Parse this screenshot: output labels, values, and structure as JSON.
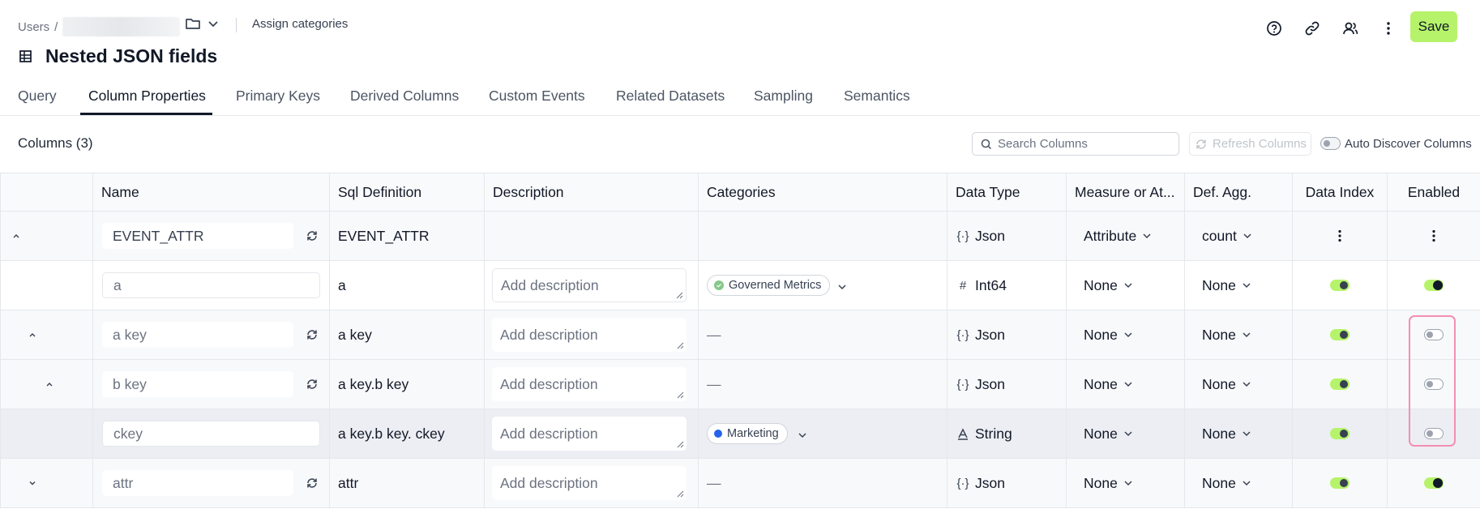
{
  "header": {
    "breadcrumb_root": "Users",
    "breadcrumb_sep": "/",
    "assign_categories": "Assign categories",
    "title": "Nested JSON fields",
    "save_label": "Save"
  },
  "tabs": [
    {
      "label": "Query"
    },
    {
      "label": "Column Properties",
      "active": true
    },
    {
      "label": "Primary Keys"
    },
    {
      "label": "Derived Columns"
    },
    {
      "label": "Custom Events"
    },
    {
      "label": "Related Datasets"
    },
    {
      "label": "Sampling"
    },
    {
      "label": "Semantics"
    }
  ],
  "toolbar": {
    "columns_count": "Columns (3)",
    "search_placeholder": "Search Columns",
    "refresh_label": "Refresh Columns",
    "auto_discover_label": "Auto Discover Columns"
  },
  "table": {
    "headers": [
      "Name",
      "Sql Definition",
      "Description",
      "Categories",
      "Data Type",
      "Measure or At...",
      "Def. Agg.",
      "Data Index",
      "Enabled"
    ],
    "rows": [
      {
        "name": "EVENT_ATTR",
        "sql": "EVENT_ATTR",
        "description": "",
        "category": "",
        "data_type": "Json",
        "measure": "Attribute",
        "agg": "count"
      },
      {
        "name": "a",
        "sql": "a",
        "description": "Add description",
        "category": "Governed Metrics",
        "data_type": "Int64",
        "measure": "None",
        "agg": "None"
      },
      {
        "name": "a key",
        "sql": "a key",
        "description": "Add description",
        "category": "—",
        "data_type": "Json",
        "measure": "None",
        "agg": "None"
      },
      {
        "name": "b key",
        "sql": "a key.b key",
        "description": "Add description",
        "category": "—",
        "data_type": "Json",
        "measure": "None",
        "agg": "None"
      },
      {
        "name": "ckey",
        "sql": "a key.b key. ckey",
        "description": "Add description",
        "category": "Marketing",
        "data_type": "String",
        "measure": "None",
        "agg": "None"
      },
      {
        "name": "attr",
        "sql": "attr",
        "description": "Add description",
        "category": "—",
        "data_type": "Json",
        "measure": "None",
        "agg": "None"
      }
    ]
  },
  "colors": {
    "accent": "#b6f36b",
    "governed_dot": "#86c98a",
    "marketing_dot": "#2563eb",
    "highlight_border": "#f48fb1"
  },
  "toggles": {
    "auto_discover": "off",
    "data_index": [
      "menu",
      "on",
      "on",
      "on",
      "on",
      "on"
    ],
    "enabled": [
      "menu",
      "on",
      "off",
      "off",
      "off",
      "on"
    ]
  }
}
